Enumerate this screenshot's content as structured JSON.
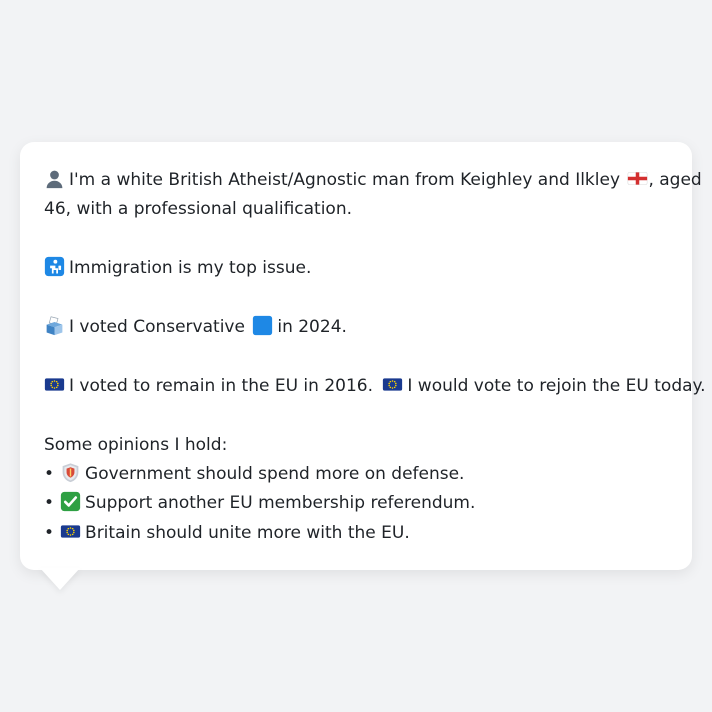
{
  "profile": {
    "intro_a": "I'm a white British Atheist/Agnostic man from Keighley and Ilkley",
    "intro_b": ", aged",
    "intro_c": "46, with a professional qualification.",
    "top_issue": "Immigration is my top issue.",
    "vote_a": "I voted Conservative",
    "vote_b": "in 2024.",
    "eu_a": "I voted to remain in the EU in 2016.",
    "eu_b": "I would vote to rejoin the EU today.",
    "opinions_heading": "Some opinions I hold:",
    "opinions": [
      {
        "bullet": "•",
        "icon": "shield-icon",
        "text": "Government should spend more on defense."
      },
      {
        "bullet": "•",
        "icon": "check-mark-icon",
        "text": "Support another EU membership referendum."
      },
      {
        "bullet": "•",
        "icon": "eu-flag-icon",
        "text": "Britain should unite more with the EU."
      }
    ]
  },
  "colors": {
    "background": "#f2f3f5",
    "card": "#ffffff",
    "text": "#1f2328",
    "conservative_blue": "#1e88e5",
    "eu_blue": "#1a3a8f",
    "eu_gold": "#ffd600",
    "check_green": "#2ea043",
    "england_red": "#d32f2f"
  }
}
